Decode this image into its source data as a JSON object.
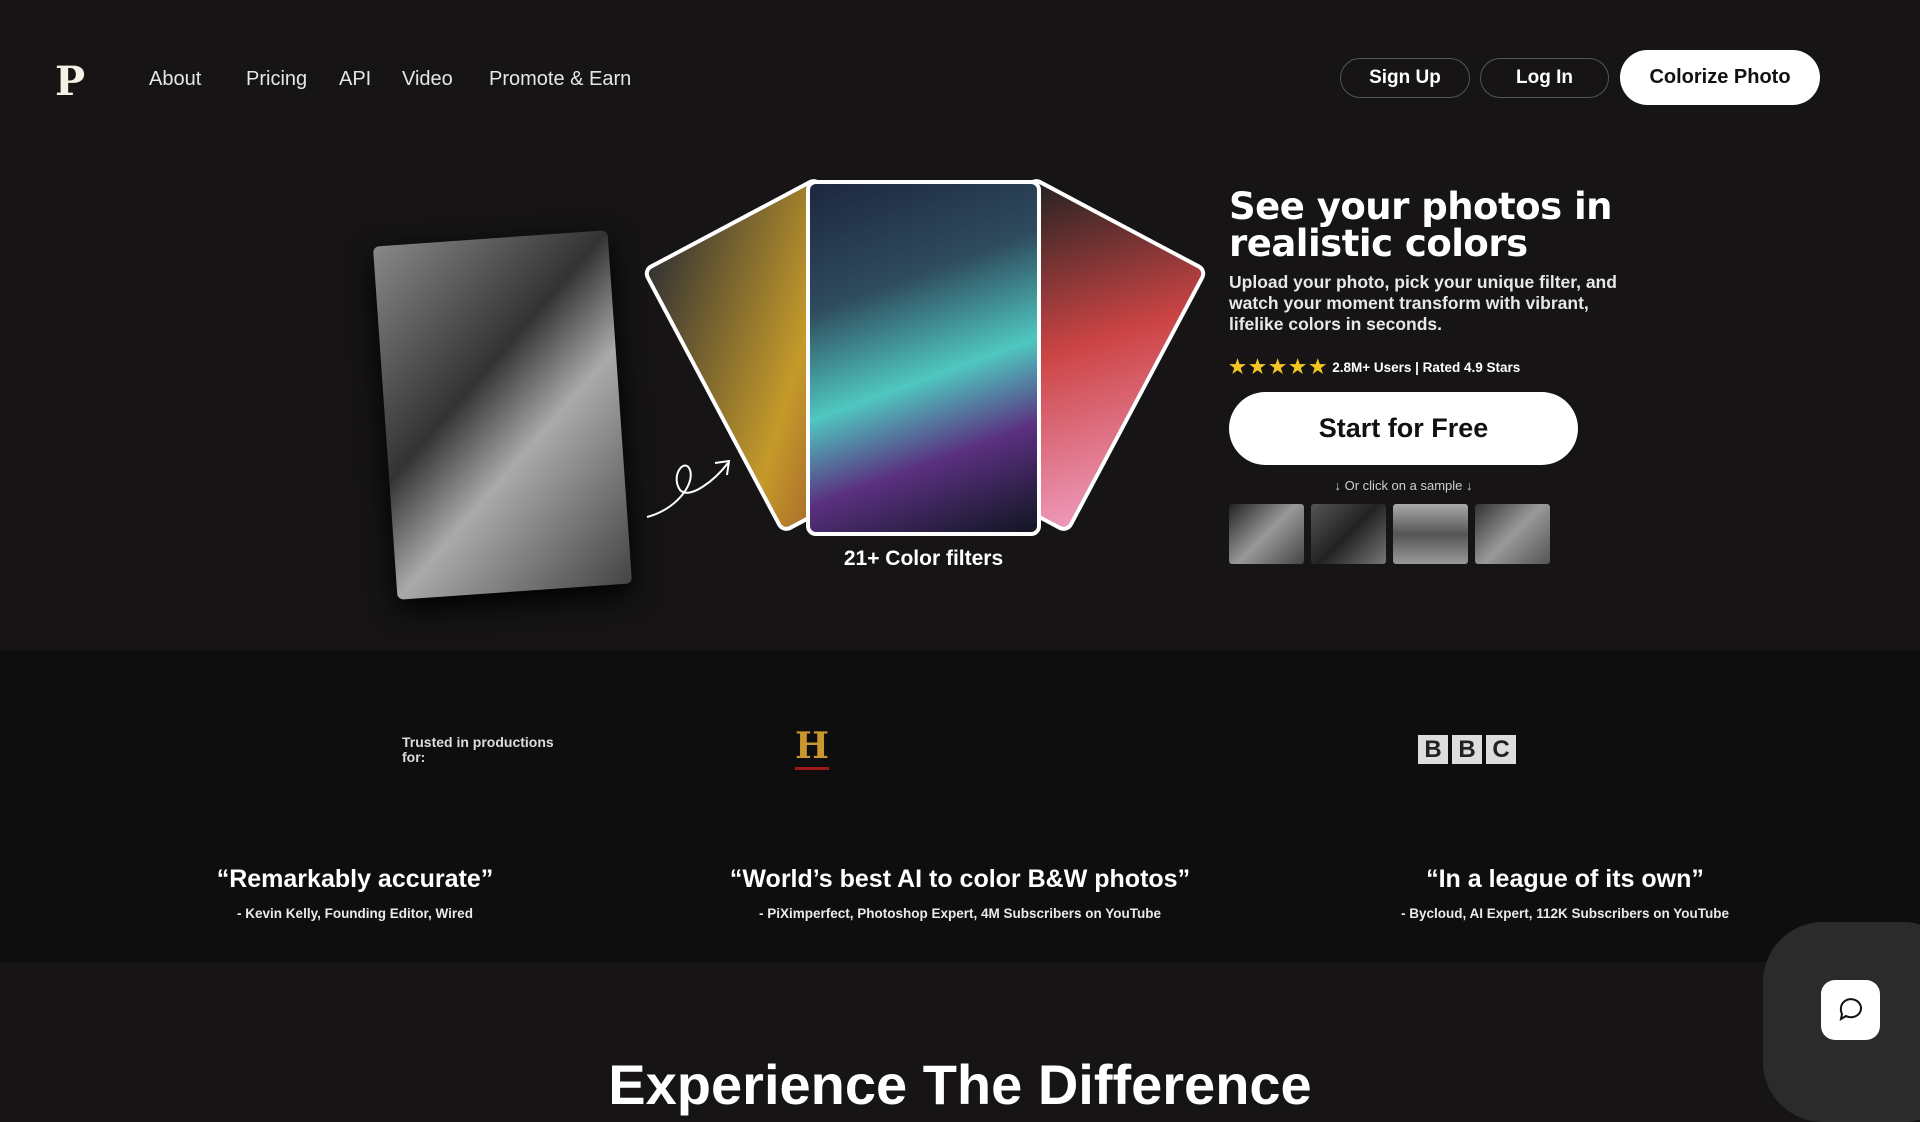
{
  "header": {
    "logo": "P",
    "nav": [
      "About",
      "Pricing",
      "API",
      "Video",
      "Promote & Earn"
    ],
    "sign_up": "Sign Up",
    "log_in": "Log In",
    "colorize": "Colorize Photo"
  },
  "hero": {
    "title": "See your photos in realistic colors",
    "description": "Upload your photo, pick your unique filter, and watch your moment transform with vibrant, lifelike colors in seconds.",
    "stars": 5,
    "rating_text": "2.8M+ Users | Rated 4.9 Stars",
    "cta": "Start for Free",
    "sample_hint": "↓ Or click on a sample ↓",
    "filters_caption": "21+ Color filters",
    "star_color": "#f3c623"
  },
  "trusted": {
    "label": "Trusted in productions for:",
    "logos": [
      "H",
      "B",
      "B",
      "C"
    ]
  },
  "quotes": [
    {
      "quote": "“Remarkably accurate”",
      "author": "- Kevin Kelly, Founding Editor, Wired"
    },
    {
      "quote": "“World’s best AI to color B&W photos”",
      "author": "- PiXimperfect, Photoshop Expert, 4M Subscribers on YouTube"
    },
    {
      "quote": "“In a league of its own”",
      "author": "- Bycloud, AI Expert, 112K Subscribers on YouTube"
    }
  ],
  "section2": {
    "title": "Experience The Difference"
  }
}
